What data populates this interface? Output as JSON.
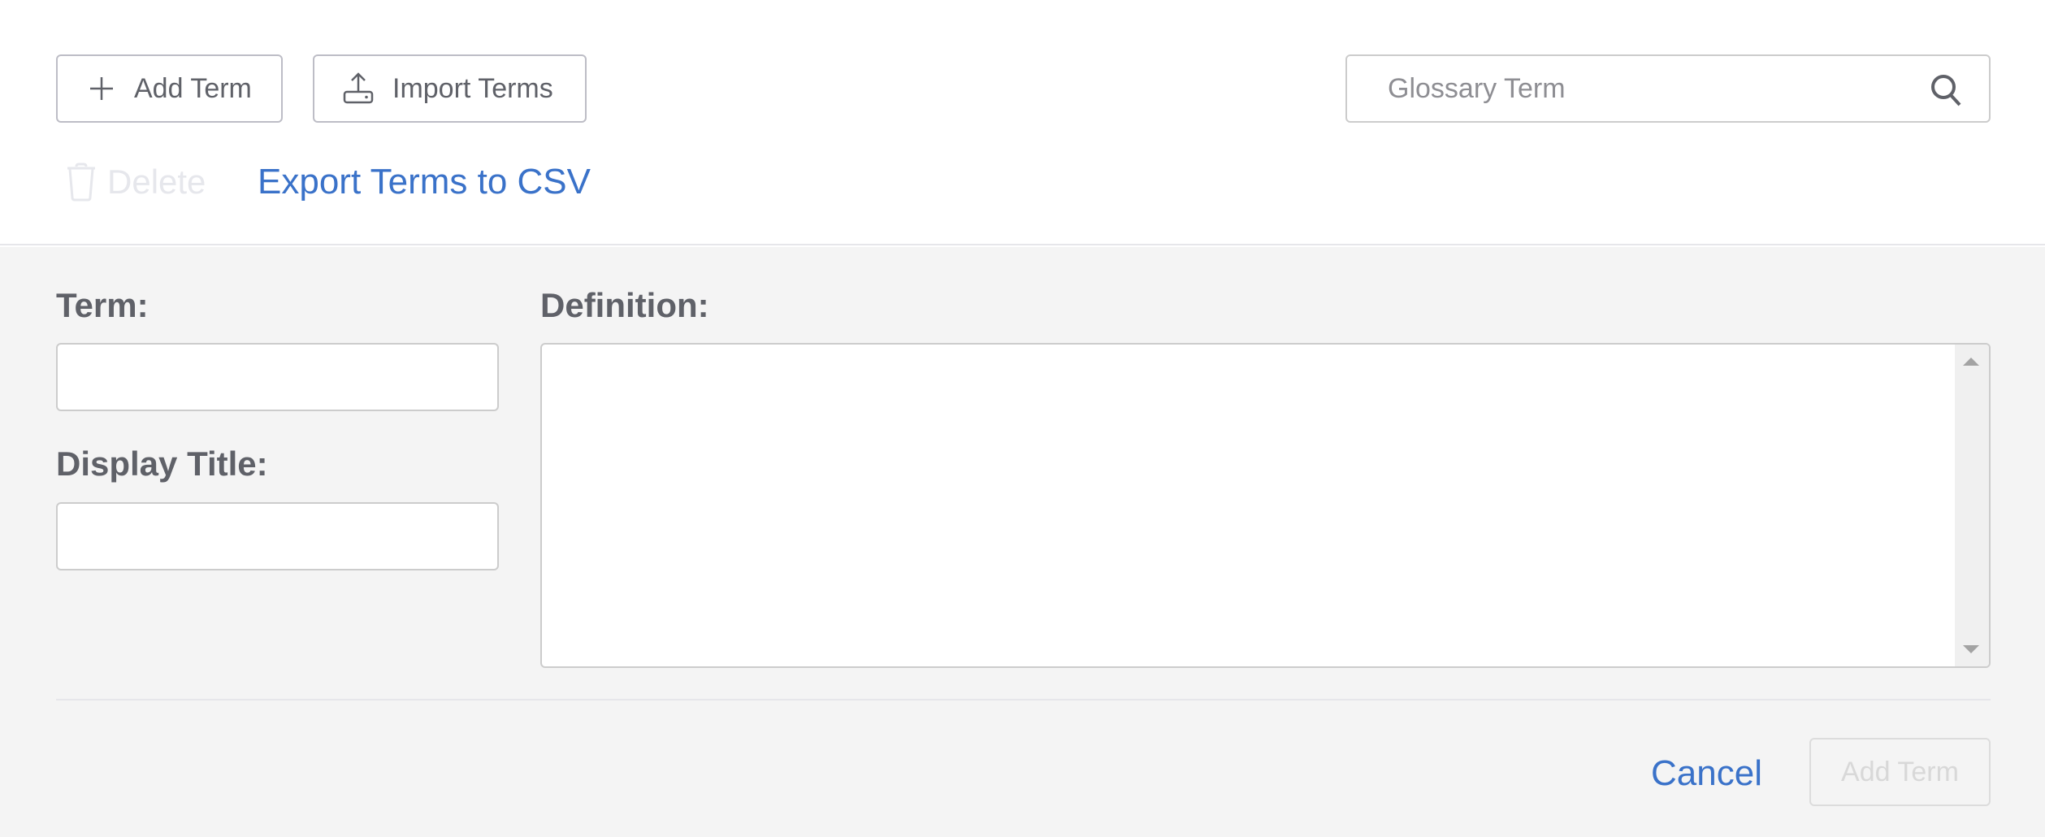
{
  "toolbar": {
    "add_term_label": "Add Term",
    "add_term_icon": "plus-icon",
    "import_terms_label": "Import Terms",
    "import_terms_icon": "upload-icon",
    "delete_label": "Delete",
    "delete_icon": "trash-icon",
    "delete_disabled": true,
    "export_label": "Export Terms to CSV"
  },
  "search": {
    "placeholder": "Glossary Term",
    "value": "",
    "icon": "search-icon"
  },
  "form": {
    "term_label": "Term:",
    "term_value": "",
    "display_title_label": "Display Title:",
    "display_title_value": "",
    "definition_label": "Definition:",
    "definition_value": "",
    "cancel_label": "Cancel",
    "submit_label": "Add Term",
    "submit_disabled": true
  },
  "colors": {
    "link": "#3a72c9",
    "text": "#5f6168",
    "disabled": "#d8d8d8",
    "form_background": "#f4f4f4"
  }
}
